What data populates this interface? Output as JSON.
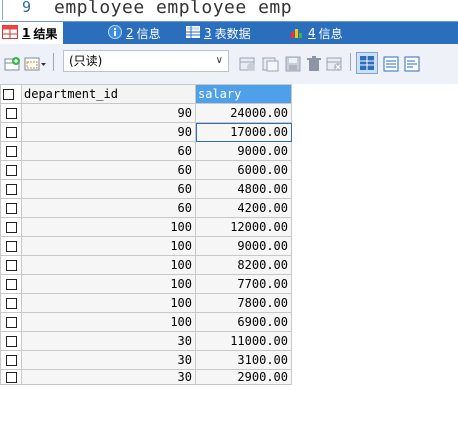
{
  "editor": {
    "line_number": "9",
    "code": "employee employee emp"
  },
  "tabs": [
    {
      "num": "1",
      "label": "结果",
      "icon": "grid-result-icon"
    },
    {
      "num": "2",
      "label": "信息",
      "icon": "info-icon"
    },
    {
      "num": "3",
      "label": "表数据",
      "icon": "table-data-icon"
    },
    {
      "num": "4",
      "label": "信息",
      "icon": "info-chart-icon"
    }
  ],
  "toolbar": {
    "mode_select": "(只读)"
  },
  "grid": {
    "columns": [
      "department_id",
      "salary"
    ],
    "rows": [
      [
        "90",
        "24000.00"
      ],
      [
        "90",
        "17000.00"
      ],
      [
        "60",
        "9000.00"
      ],
      [
        "60",
        "6000.00"
      ],
      [
        "60",
        "4800.00"
      ],
      [
        "60",
        "4200.00"
      ],
      [
        "100",
        "12000.00"
      ],
      [
        "100",
        "9000.00"
      ],
      [
        "100",
        "8200.00"
      ],
      [
        "100",
        "7700.00"
      ],
      [
        "100",
        "7800.00"
      ],
      [
        "100",
        "6900.00"
      ],
      [
        "30",
        "11000.00"
      ],
      [
        "30",
        "3100.00"
      ],
      [
        "30",
        "2900.00"
      ]
    ]
  },
  "colors": {
    "tab_bar": "#2a6ebd",
    "header_highlight": "#4ea0ea",
    "selected_row": "#cfe2f7"
  }
}
